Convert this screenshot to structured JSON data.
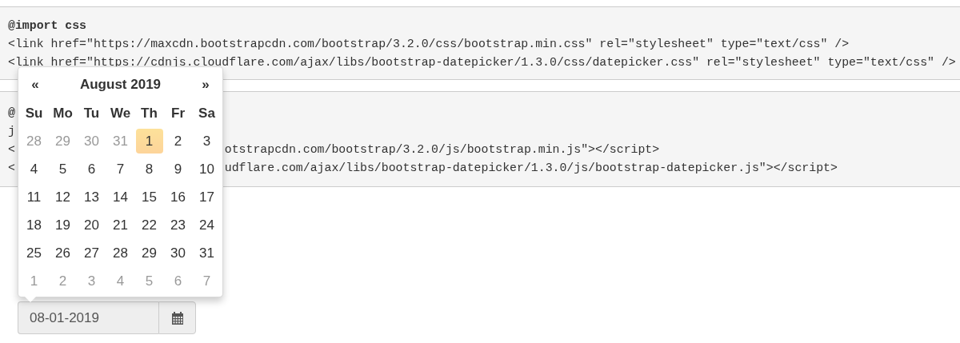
{
  "code_blocks": [
    {
      "lines": [
        {
          "text": "@import css",
          "bold": true
        },
        {
          "text": "<link href=\"https://maxcdn.bootstrapcdn.com/bootstrap/3.2.0/css/bootstrap.min.css\" rel=\"stylesheet\" type=\"text/css\" />",
          "bold": false
        },
        {
          "text": "<link href=\"https://cdnjs.cloudflare.com/ajax/libs/bootstrap-datepicker/1.3.0/css/datepicker.css\" rel=\"stylesheet\" type=\"text/css\" />",
          "bold": false
        }
      ]
    },
    {
      "lines": [
        {
          "text": "@",
          "bold": true
        },
        {
          "text": "j",
          "bold": false
        },
        {
          "text": "<",
          "after": "otstrapcdn.com/bootstrap/3.2.0/js/bootstrap.min.js\"></script>",
          "bold": false
        },
        {
          "text": "<",
          "after": "udflare.com/ajax/libs/bootstrap-datepicker/1.3.0/js/bootstrap-datepicker.js\"></script>",
          "bold": false
        }
      ]
    }
  ],
  "datepicker": {
    "prev": "«",
    "title": "August 2019",
    "next": "»",
    "weekdays": [
      "Su",
      "Mo",
      "Tu",
      "We",
      "Th",
      "Fr",
      "Sa"
    ],
    "weeks": [
      [
        {
          "day": "28",
          "muted": true,
          "selected": false
        },
        {
          "day": "29",
          "muted": true,
          "selected": false
        },
        {
          "day": "30",
          "muted": true,
          "selected": false
        },
        {
          "day": "31",
          "muted": true,
          "selected": false
        },
        {
          "day": "1",
          "muted": false,
          "selected": true
        },
        {
          "day": "2",
          "muted": false,
          "selected": false
        },
        {
          "day": "3",
          "muted": false,
          "selected": false
        }
      ],
      [
        {
          "day": "4",
          "muted": false,
          "selected": false
        },
        {
          "day": "5",
          "muted": false,
          "selected": false
        },
        {
          "day": "6",
          "muted": false,
          "selected": false
        },
        {
          "day": "7",
          "muted": false,
          "selected": false
        },
        {
          "day": "8",
          "muted": false,
          "selected": false
        },
        {
          "day": "9",
          "muted": false,
          "selected": false
        },
        {
          "day": "10",
          "muted": false,
          "selected": false
        }
      ],
      [
        {
          "day": "11",
          "muted": false,
          "selected": false
        },
        {
          "day": "12",
          "muted": false,
          "selected": false
        },
        {
          "day": "13",
          "muted": false,
          "selected": false
        },
        {
          "day": "14",
          "muted": false,
          "selected": false
        },
        {
          "day": "15",
          "muted": false,
          "selected": false
        },
        {
          "day": "16",
          "muted": false,
          "selected": false
        },
        {
          "day": "17",
          "muted": false,
          "selected": false
        }
      ],
      [
        {
          "day": "18",
          "muted": false,
          "selected": false
        },
        {
          "day": "19",
          "muted": false,
          "selected": false
        },
        {
          "day": "20",
          "muted": false,
          "selected": false
        },
        {
          "day": "21",
          "muted": false,
          "selected": false
        },
        {
          "day": "22",
          "muted": false,
          "selected": false
        },
        {
          "day": "23",
          "muted": false,
          "selected": false
        },
        {
          "day": "24",
          "muted": false,
          "selected": false
        }
      ],
      [
        {
          "day": "25",
          "muted": false,
          "selected": false
        },
        {
          "day": "26",
          "muted": false,
          "selected": false
        },
        {
          "day": "27",
          "muted": false,
          "selected": false
        },
        {
          "day": "28",
          "muted": false,
          "selected": false
        },
        {
          "day": "29",
          "muted": false,
          "selected": false
        },
        {
          "day": "30",
          "muted": false,
          "selected": false
        },
        {
          "day": "31",
          "muted": false,
          "selected": false
        }
      ],
      [
        {
          "day": "1",
          "muted": true,
          "selected": false
        },
        {
          "day": "2",
          "muted": true,
          "selected": false
        },
        {
          "day": "3",
          "muted": true,
          "selected": false
        },
        {
          "day": "4",
          "muted": true,
          "selected": false
        },
        {
          "day": "5",
          "muted": true,
          "selected": false
        },
        {
          "day": "6",
          "muted": true,
          "selected": false
        },
        {
          "day": "7",
          "muted": true,
          "selected": false
        }
      ]
    ]
  },
  "date_input": {
    "value": "08-01-2019"
  }
}
